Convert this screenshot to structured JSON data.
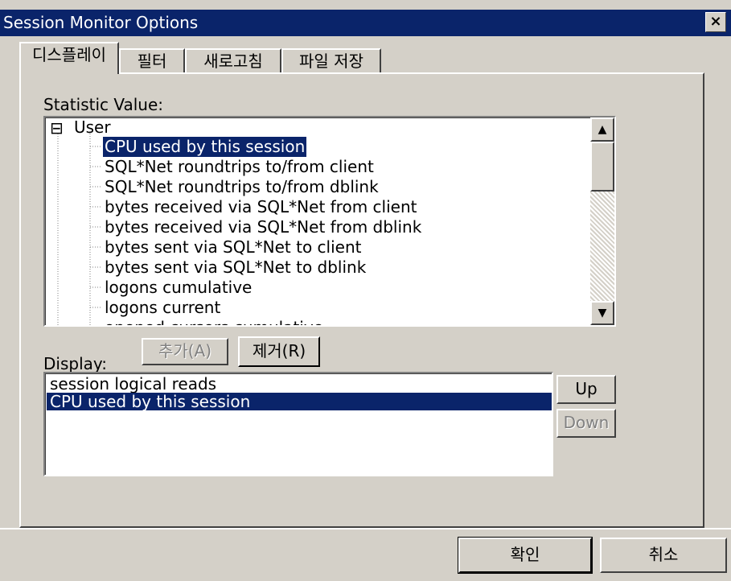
{
  "window": {
    "title": "Session Monitor Options",
    "close_label": "×",
    "accent_color": "#0a246a"
  },
  "tabs": [
    {
      "label": "디스플레이",
      "active": true
    },
    {
      "label": "필터",
      "active": false
    },
    {
      "label": "새로고침",
      "active": false
    },
    {
      "label": "파일 저장",
      "active": false
    }
  ],
  "statistic": {
    "label": "Statistic Value:",
    "root_toggle": "⊟",
    "root_label": "User",
    "items": [
      "CPU used by this session",
      "SQL*Net roundtrips to/from client",
      "SQL*Net roundtrips to/from dblink",
      "bytes received via SQL*Net from client",
      "bytes received via SQL*Net from dblink",
      "bytes sent via SQL*Net to client",
      "bytes sent via SQL*Net to dblink",
      "logons cumulative",
      "logons current",
      "opened cursors cumulative"
    ],
    "selected_index": 0
  },
  "display": {
    "label": "Display:",
    "add_button": "추가(A)",
    "remove_button": "제거(R)",
    "items": [
      "session logical reads",
      "CPU used by this session"
    ],
    "selected_index": 1,
    "up_button": "Up",
    "down_button": "Down"
  },
  "footer": {
    "ok_button": "확인",
    "cancel_button": "취소"
  },
  "icons": {
    "scroll_up": "▲",
    "scroll_down": "▼"
  }
}
